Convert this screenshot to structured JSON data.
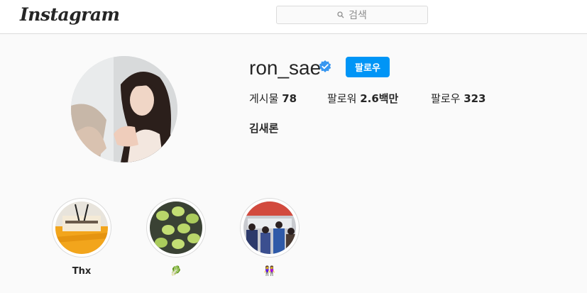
{
  "header": {
    "logo_text": "Instagram",
    "search_placeholder": "검색",
    "search_icon": "search-icon"
  },
  "profile": {
    "username": "ron_sae",
    "verified": true,
    "verified_icon": "verified-badge-icon",
    "follow_label": "팔로우",
    "stats": {
      "posts_label": "게시물",
      "posts_value": "78",
      "followers_label": "팔로워",
      "followers_value": "2.6백만",
      "following_label": "팔로우",
      "following_value": "323"
    },
    "full_name": "김새론"
  },
  "highlights": [
    {
      "label": "Thx"
    },
    {
      "label": "🥬"
    },
    {
      "label": "👭"
    }
  ],
  "colors": {
    "accent": "#0095f6",
    "background": "#fafafa",
    "border": "#dbdbdb",
    "text": "#262626",
    "muted": "#8e8e8e"
  }
}
